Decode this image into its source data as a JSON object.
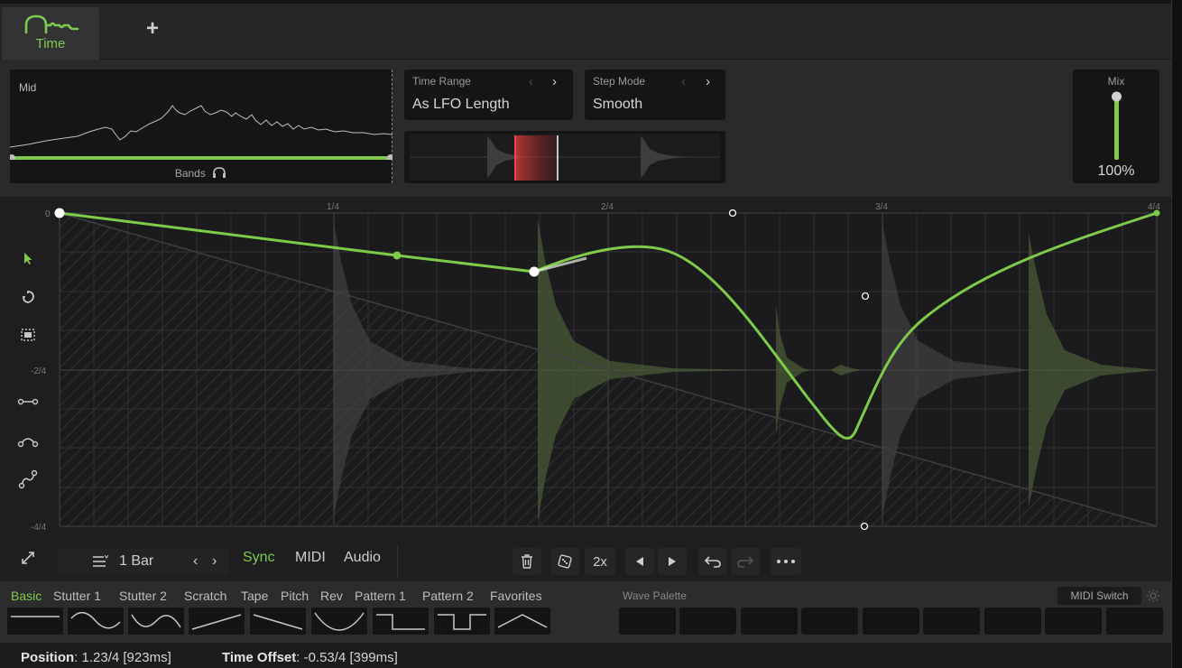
{
  "tabs": {
    "time_label": "Time",
    "add_symbol": "+"
  },
  "mid_panel": {
    "label": "Mid",
    "bands_label": "Bands"
  },
  "time_range": {
    "title": "Time Range",
    "value": "As LFO Length"
  },
  "step_mode": {
    "title": "Step Mode",
    "value": "Smooth"
  },
  "mix": {
    "title": "Mix",
    "value": "100%",
    "level": 1.0
  },
  "grid": {
    "x_labels": [
      "1/4",
      "2/4",
      "3/4",
      "4/4"
    ],
    "y_labels": [
      "0",
      "-2/4",
      "-4/4"
    ]
  },
  "bottombar": {
    "length": "1 Bar",
    "sync": "Sync",
    "midi": "MIDI",
    "audio": "Audio",
    "multiplier": "2x"
  },
  "palette": {
    "tabs": [
      "Basic",
      "Stutter 1",
      "Stutter 2",
      "Scratch",
      "Tape",
      "Pitch",
      "Rev",
      "Pattern 1",
      "Pattern 2",
      "Favorites"
    ],
    "active_tab": "Basic",
    "wave_palette_title": "Wave Palette",
    "midi_switch": "MIDI Switch"
  },
  "status": {
    "position_label": "Position",
    "position_value": ": 1.23/4 [923ms]",
    "offset_label": "Time Offset",
    "offset_value": ": -0.53/4 [399ms]"
  },
  "colors": {
    "accent": "#7ecb4a",
    "background": "#1e1e20",
    "panel": "#151516"
  }
}
